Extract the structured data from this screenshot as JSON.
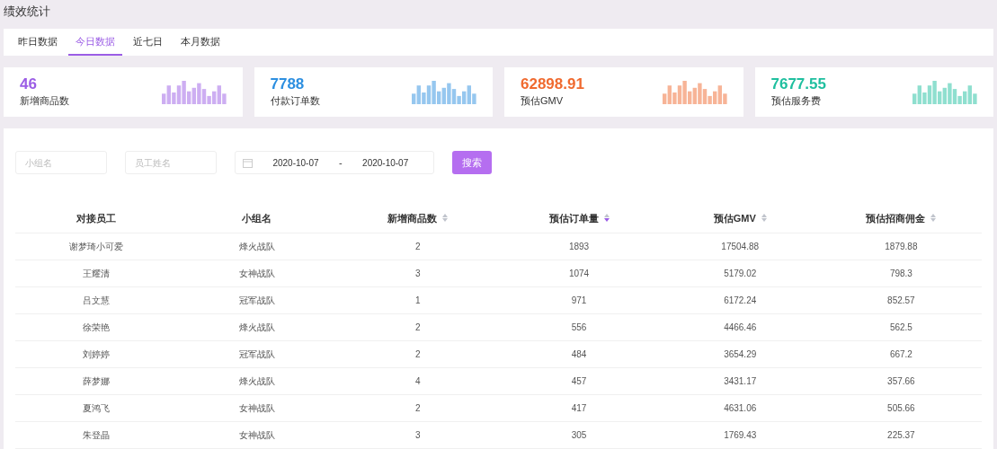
{
  "page_title": "绩效统计",
  "tabs": [
    {
      "label": "昨日数据",
      "selected": false
    },
    {
      "label": "今日数据",
      "selected": true
    },
    {
      "label": "近七日",
      "selected": false
    },
    {
      "label": "本月数据",
      "selected": false
    }
  ],
  "stats": [
    {
      "value": "46",
      "label": "新增商品数",
      "color": "#9b5de5"
    },
    {
      "value": "7788",
      "label": "付款订单数",
      "color": "#2d8fe0"
    },
    {
      "value": "62898.91",
      "label": "预估GMV",
      "color": "#f06a2f"
    },
    {
      "value": "7677.55",
      "label": "预估服务费",
      "color": "#1fbf9f"
    }
  ],
  "filters": {
    "group": {
      "placeholder": "小组名"
    },
    "employee": {
      "placeholder": "员工姓名"
    },
    "date_start": "2020-10-07",
    "date_separator": "-",
    "date_end": "2020-10-07",
    "search_button": "搜索"
  },
  "table": {
    "columns": [
      {
        "label": "对接员工",
        "sortable": false
      },
      {
        "label": "小组名",
        "sortable": false
      },
      {
        "label": "新增商品数",
        "sortable": true,
        "sorted_descending": false
      },
      {
        "label": "预估订单量",
        "sortable": true,
        "sorted_descending": true
      },
      {
        "label": "预估GMV",
        "sortable": true,
        "sorted_descending": false
      },
      {
        "label": "预估招商佣金",
        "sortable": true,
        "sorted_descending": false
      }
    ],
    "rows": [
      [
        "谢梦琦小可爱",
        "烽火战队",
        "2",
        "1893",
        "17504.88",
        "1879.88"
      ],
      [
        "王耀清",
        "女神战队",
        "3",
        "1074",
        "5179.02",
        "798.3"
      ],
      [
        "吕文慧",
        "冠军战队",
        "1",
        "971",
        "6172.24",
        "852.57"
      ],
      [
        "徐荣艳",
        "烽火战队",
        "2",
        "556",
        "4466.46",
        "562.5"
      ],
      [
        "刘婷婷",
        "冠军战队",
        "2",
        "484",
        "3654.29",
        "667.2"
      ],
      [
        "薛梦娜",
        "烽火战队",
        "4",
        "457",
        "3431.17",
        "357.66"
      ],
      [
        "夏鸿飞",
        "女神战队",
        "2",
        "417",
        "4631.06",
        "505.66"
      ],
      [
        "朱登晶",
        "女神战队",
        "3",
        "305",
        "1769.43",
        "225.37"
      ]
    ]
  }
}
